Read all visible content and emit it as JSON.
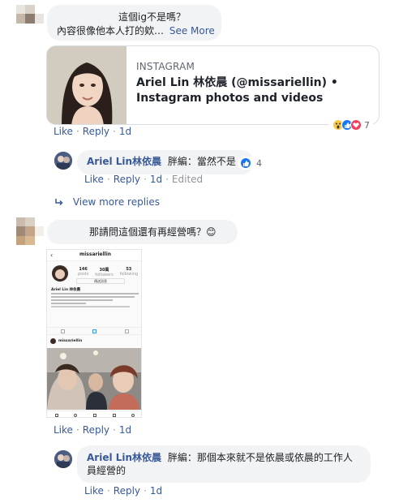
{
  "comment1": {
    "text_line1": "這個ig不是嗎？",
    "text_line2": "內容很像他本人打的欸…",
    "see_more": "See More",
    "card": {
      "site": "INSTAGRAM",
      "title": "Ariel Lin 林依晨 (@missariellin) • Instagram photos and videos"
    },
    "actions": {
      "like": "Like",
      "reply": "Reply",
      "time": "1d"
    },
    "reactions_count": "7"
  },
  "reply1": {
    "author": "Ariel Lin林依晨",
    "text": "胖編：當然不是",
    "reactions_count": "4",
    "actions": {
      "like": "Like",
      "reply": "Reply",
      "time": "1d",
      "edited": "Edited"
    }
  },
  "view_more": "View more replies",
  "comment2": {
    "text": "那請問這個還有再經營嗎？😊",
    "screenshot": {
      "username": "missariellin",
      "stats": [
        "146",
        "30萬",
        "53"
      ],
      "stat_labels": [
        "posts",
        "followers",
        "following"
      ],
      "follow_btn": "傳送訊息",
      "bio_name": "Ariel Lin 林依晨",
      "post_user": "missariellin"
    },
    "actions": {
      "like": "Like",
      "reply": "Reply",
      "time": "1d"
    }
  },
  "reply2": {
    "author": "Ariel Lin林依晨",
    "text_line1": "胖編：那個本來就不是依晨或依晨的工作人",
    "text_line2": "員經營的",
    "actions": {
      "like": "Like",
      "reply": "Reply",
      "time": "1d"
    }
  },
  "colors": {
    "link": "#385898",
    "muted": "#90949c",
    "bubble": "#f2f3f5",
    "like_blue": "#1877f2"
  }
}
